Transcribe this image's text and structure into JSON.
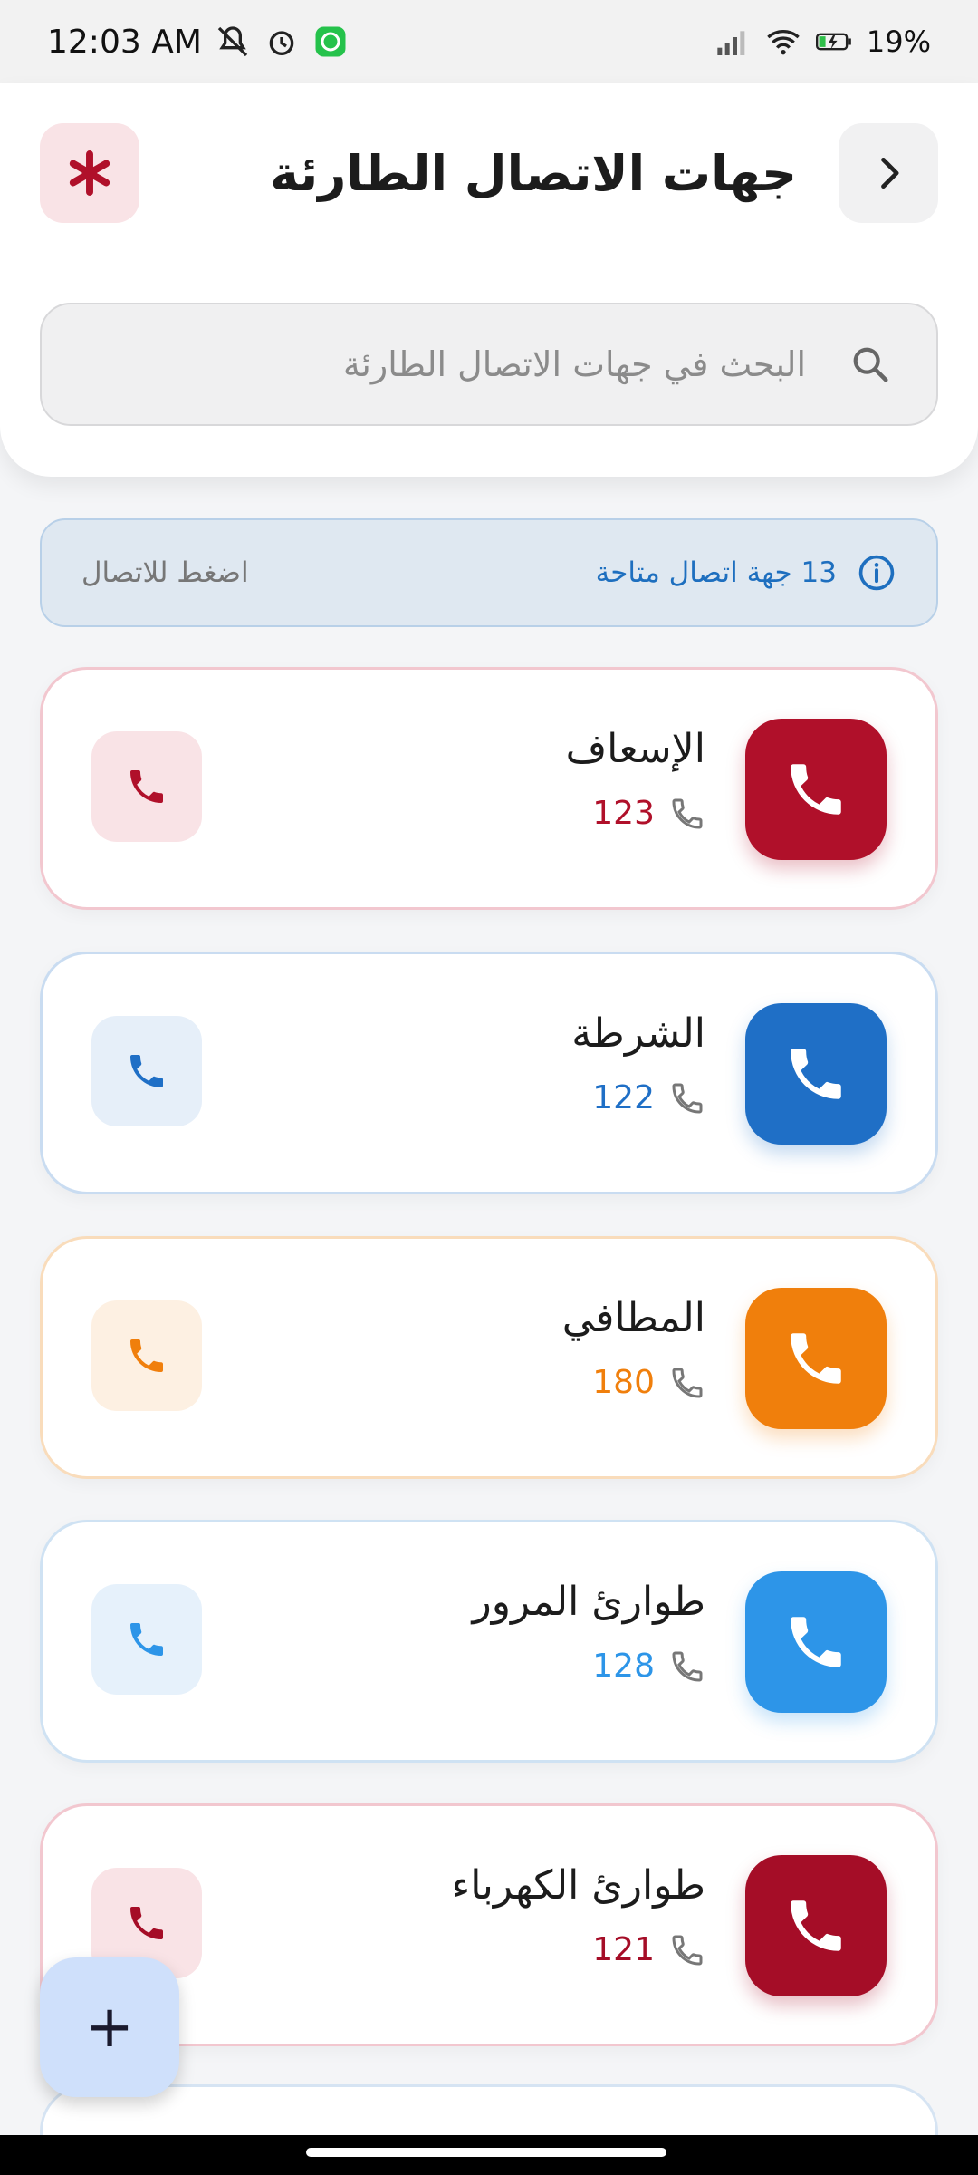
{
  "status_bar": {
    "time": "12:03 AM",
    "battery": "19%",
    "icons": [
      "mute-icon",
      "alarm-icon",
      "whatsapp-icon",
      "signal-icon",
      "wifi-icon",
      "battery-charging-icon"
    ]
  },
  "header": {
    "title": "جهات الاتصال الطارئة",
    "back_icon": "chevron-right-icon",
    "emergency_icon": "asterisk-icon"
  },
  "search": {
    "placeholder": "البحث في جهات الاتصال الطارئة",
    "icon": "search-icon"
  },
  "info": {
    "count_text": "13 جهة اتصال متاحة",
    "hint_text": "اضغط للاتصال",
    "icon": "info-icon"
  },
  "contacts": [
    {
      "name": "الإسعاف",
      "number": "123",
      "color": "#b0102a",
      "tint": "#f9e3e6",
      "border": "#f2c7cf"
    },
    {
      "name": "الشرطة",
      "number": "122",
      "color": "#1f6fc6",
      "tint": "#e6eff9",
      "border": "#c9dcf1"
    },
    {
      "name": "المطافي",
      "number": "180",
      "color": "#f07f0c",
      "tint": "#fdf0e2",
      "border": "#f9dcbb"
    },
    {
      "name": "طوارئ المرور",
      "number": "128",
      "color": "#2d95e8",
      "tint": "#e6f1fb",
      "border": "#cfe2f3"
    },
    {
      "name": "طوارئ الكهرباء",
      "number": "121",
      "color": "#a50d27",
      "tint": "#f9e3e6",
      "border": "#f2c7cf"
    }
  ],
  "fab": {
    "label": "+"
  }
}
